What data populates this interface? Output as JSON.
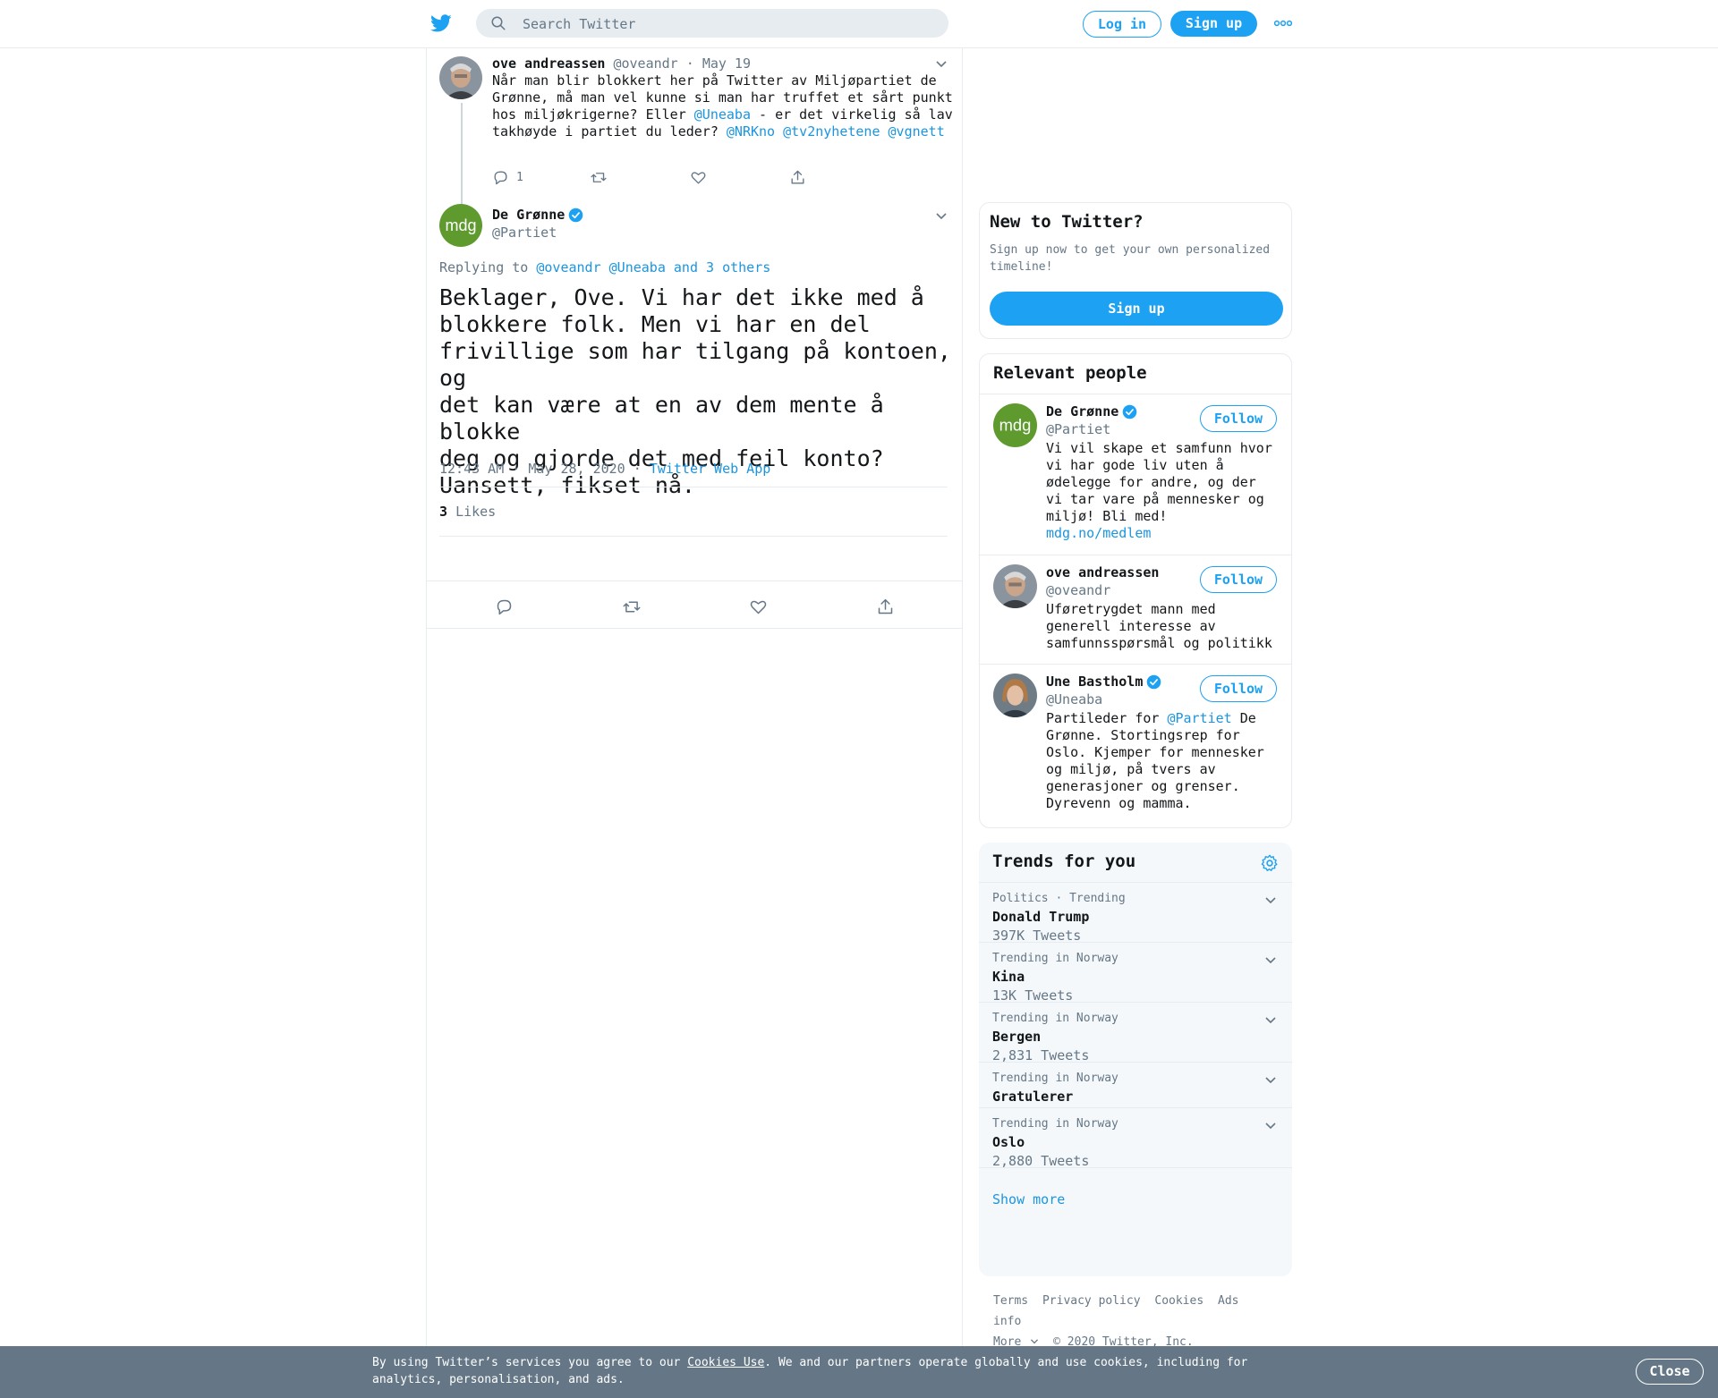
{
  "header": {
    "search_placeholder": "Search Twitter",
    "login_label": "Log in",
    "signup_label": "Sign up"
  },
  "tweet1": {
    "name": "ove andreassen",
    "handle": "@oveandr",
    "date": "May 19",
    "text_1": "Når man blir blokkert her på Twitter av Miljøpartiet de Grønne, må man vel kunne si man har truffet et sårt punkt hos miljøkrigerne? Eller ",
    "mention_1": "@Uneaba",
    "text_2": " - er det virkelig så lav takhøyde i partiet du leder? ",
    "mention_2": "@NRKno",
    "mention_3": "@tv2nyhetene",
    "mention_4": "@vgnett",
    "reply_count": "1"
  },
  "tweet2": {
    "name": "De Grønne",
    "handle": "@Partiet",
    "replying_label": "Replying to",
    "replying_to": "@oveandr @Uneaba and 3 others",
    "text": "Beklager, Ove. Vi har det ikke med å\nblokkere folk. Men vi har en del\nfrivillige som har tilgang på kontoen, og\ndet kan være at en av dem mente å blokke\ndeg og gjorde det med feil konto?\nUansett, fikset nå.",
    "timestamp": "12:43 AM · May 28, 2020",
    "source": "Twitter Web App",
    "likes_count": "3",
    "likes_label": "Likes"
  },
  "new_to_twitter": {
    "title": "New to Twitter?",
    "subtitle": "Sign up now to get your own personalized timeline!",
    "button": "Sign up"
  },
  "relevant_people": {
    "title": "Relevant people",
    "follow_label": "Follow",
    "people": [
      {
        "name": "De Grønne",
        "handle": "@Partiet",
        "bio": "Vi vil skape et samfunn hvor vi har gode liv uten å ødelegge for andre, og der vi tar vare på mennesker og miljø! Bli med!",
        "link": "mdg.no/medlem"
      },
      {
        "name": "ove andreassen",
        "handle": "@oveandr",
        "bio": "Uføretrygdet mann med generell interesse av samfunnsspørsmål og politikk"
      },
      {
        "name": "Une Bastholm",
        "handle": "@Uneaba",
        "bio_1": "Partileder for ",
        "bio_mention": "@Partiet",
        "bio_2": " De Grønne. Stortingsrep for Oslo. Kjemper for mennesker og miljø, på tvers av generasjoner og grenser. Dyrevenn og mamma."
      }
    ]
  },
  "trends": {
    "title": "Trends for you",
    "items": [
      {
        "meta": "Politics · Trending",
        "name": "Donald Trump",
        "count": "397K Tweets"
      },
      {
        "meta": "Trending in Norway",
        "name": "Kina",
        "count": "13K Tweets"
      },
      {
        "meta": "Trending in Norway",
        "name": "Bergen",
        "count": "2,831 Tweets"
      },
      {
        "meta": "Trending in Norway",
        "name": "Gratulerer",
        "count": ""
      },
      {
        "meta": "Trending in Norway",
        "name": "Oslo",
        "count": "2,880 Tweets"
      }
    ],
    "show_more": "Show more"
  },
  "footer": {
    "terms": "Terms",
    "privacy": "Privacy policy",
    "cookies": "Cookies",
    "ads": "Ads info",
    "more": "More",
    "copyright": "© 2020 Twitter, Inc."
  },
  "cookie_banner": {
    "text_1": "By using Twitter’s services you agree to our ",
    "link": "Cookies Use",
    "text_2": ". We and our partners operate globally and use cookies, including for analytics, personalisation, and ads.",
    "close": "Close"
  },
  "colors": {
    "brand_blue": "#1da1f2",
    "link_blue": "#1b95e0",
    "muted_gray": "#657786",
    "mdg_green": "#5f9a2f"
  }
}
